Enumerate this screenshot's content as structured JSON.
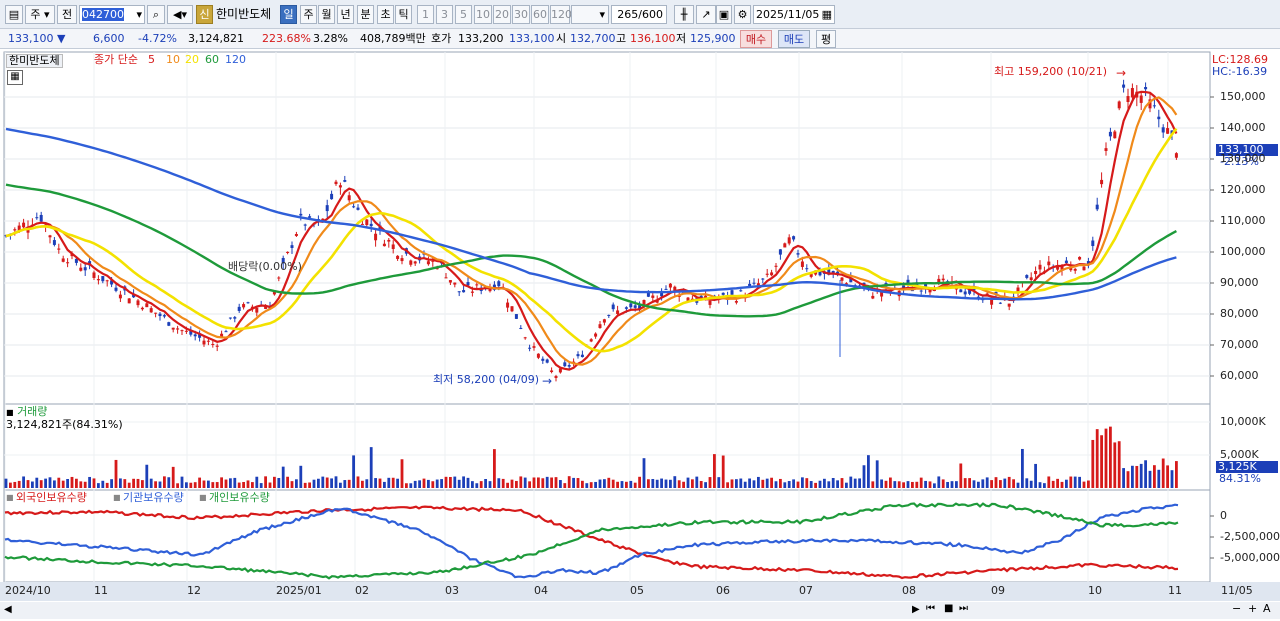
{
  "toolbar": {
    "period_label": "주",
    "prev_label": "전",
    "code_value": "042700",
    "new_badge": "신",
    "stock_name": "한미반도체",
    "timeframes": [
      "일",
      "주",
      "월",
      "년",
      "분",
      "초",
      "틱"
    ],
    "active_timeframe": "일",
    "counts": [
      "1",
      "3",
      "5",
      "10",
      "20",
      "30",
      "60",
      "120"
    ],
    "count_display": "265",
    "count_total": "/600",
    "date_value": "2025/11/05"
  },
  "info": {
    "price": "133,100",
    "change": "6,600",
    "change_pct": "-4.72%",
    "volume": "3,124,821",
    "vol_ratio": "223.68%",
    "turnover": "3.28%",
    "amount": "408,789백만",
    "quote_label": "호가",
    "ask": "133,200",
    "bid": "133,100",
    "open_label": "시",
    "open": "132,700",
    "high_label": "고",
    "high": "136,100",
    "low_label": "저",
    "low": "125,900",
    "buy_label": "매수",
    "sell_label": "매도",
    "eval_label": "평"
  },
  "price_panel": {
    "name": "한미반도체",
    "ma_title": "종가 단순",
    "ma_periods": [
      "5",
      "10",
      "20",
      "60",
      "120"
    ],
    "ma_colors": [
      "#d61a1a",
      "#f08a1a",
      "#f3e200",
      "#1e9a3a",
      "#2f5fd8"
    ],
    "lc": "LC:128.69",
    "hc": "HC:-16.39",
    "current_price": "133,100",
    "current_pct": "-2.13%",
    "high_note": "최고 159,200 (10/21)",
    "low_note": "최저 58,200 (04/09)",
    "dividend_note": "배당락(0.00%)",
    "y_ticks": [
      "150,000",
      "140,000",
      "130,000",
      "120,000",
      "110,000",
      "100,000",
      "90,000",
      "80,000",
      "70,000",
      "60,000"
    ]
  },
  "volume_panel": {
    "title": "거래량",
    "last": "3,124,821주(84.31%)",
    "y_ticks": [
      "10,000K",
      "5,000K"
    ],
    "current": "3,125K",
    "current_pct": "84.31%"
  },
  "holder_panel": {
    "series": [
      "외국인보유수량",
      "기관보유수량",
      "개인보유수량"
    ],
    "colors": [
      "#d61a1a",
      "#2f5fd8",
      "#1e9a3a"
    ],
    "y_ticks": [
      "0",
      "-2,500,000",
      "-5,000,000"
    ]
  },
  "x_axis": [
    "2024/10",
    "11",
    "12",
    "2025/01",
    "02",
    "03",
    "04",
    "05",
    "06",
    "07",
    "08",
    "09",
    "10",
    "11",
    "11/05"
  ]
}
